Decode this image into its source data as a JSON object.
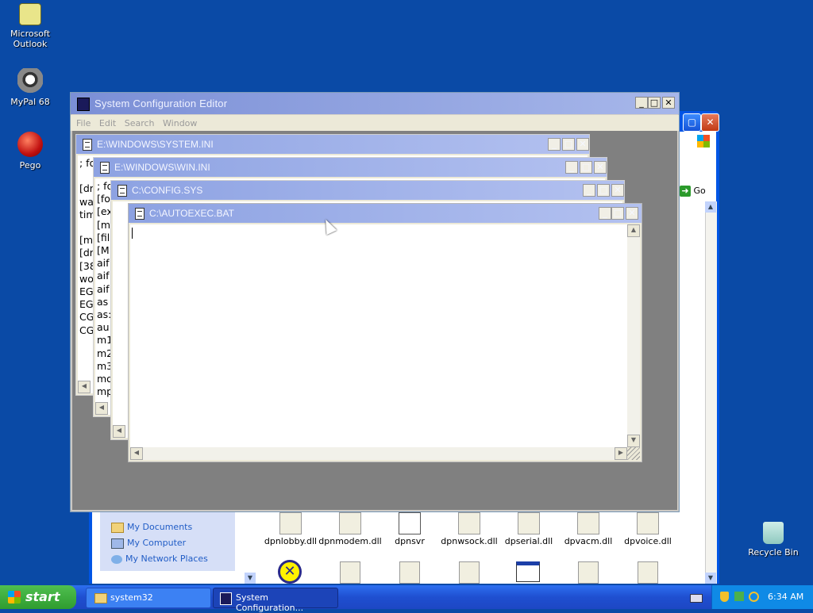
{
  "desktop_icons": [
    {
      "label_1": "Microsoft",
      "label_2": "Outlook",
      "icon": "outlook-icon"
    },
    {
      "label_1": "MyPal 68",
      "icon": "mypal-raccoon-icon"
    },
    {
      "label_1": "Pego",
      "icon": "pego-icon"
    },
    {
      "label_1": "Recycle Bin",
      "icon": "recycle-bin-icon"
    }
  ],
  "background_window": {
    "go_label": "Go",
    "places": [
      "My Documents",
      "My Computer",
      "My Network Places"
    ],
    "files": [
      "dpnlobby.dll",
      "dpnmodem.dll",
      "dpnsvr",
      "dpnwsock.dll",
      "dpserial.dll",
      "dpvacm.dll",
      "dpvoice.dll"
    ]
  },
  "sysedit": {
    "title": "System Configuration Editor",
    "menu": [
      "File",
      "Edit",
      "Search",
      "Window"
    ],
    "children": [
      {
        "title": "E:\\WINDOWS\\SYSTEM.INI",
        "lines": [
          "; fo",
          "",
          "[dr",
          "wa",
          "tim",
          "",
          "[m",
          "[dr",
          "[38",
          "wo",
          "EG",
          "EG",
          "CG",
          "CG"
        ]
      },
      {
        "title": "E:\\WINDOWS\\WIN.INI",
        "lines": [
          "; fo",
          "[for",
          "[ex",
          "[m",
          "[fil",
          "[M",
          "aif",
          "aif",
          "aif",
          "as",
          "as:",
          "au",
          "m1",
          "m2",
          "m3",
          "mo",
          "mp"
        ]
      },
      {
        "title": "C:\\CONFIG.SYS",
        "lines": []
      },
      {
        "title": "C:\\AUTOEXEC.BAT",
        "lines": []
      }
    ]
  },
  "taskbar": {
    "start_label": "start",
    "tasks": [
      "system32",
      "System Configuration..."
    ],
    "clock": "6:34 AM"
  }
}
